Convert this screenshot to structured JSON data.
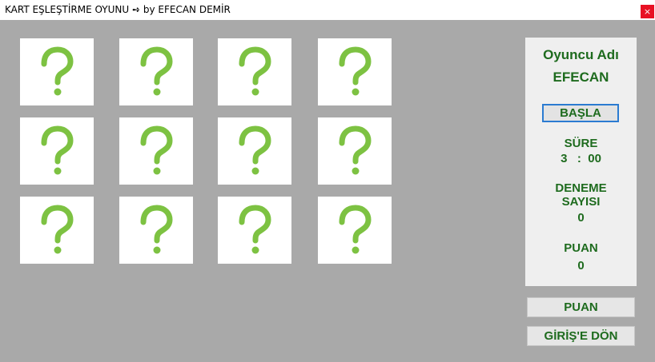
{
  "window": {
    "title": "KART EŞLEŞTİRME OYUNU ➺ by EFECAN DEMİR",
    "close_label": "×"
  },
  "cards": [
    {
      "face": "?"
    },
    {
      "face": "?"
    },
    {
      "face": "?"
    },
    {
      "face": "?"
    },
    {
      "face": "?"
    },
    {
      "face": "?"
    },
    {
      "face": "?"
    },
    {
      "face": "?"
    },
    {
      "face": "?"
    },
    {
      "face": "?"
    },
    {
      "face": "?"
    },
    {
      "face": "?"
    }
  ],
  "panel": {
    "player_label": "Oyuncu Adı",
    "player_name": "EFECAN",
    "start_button": "BAŞLA",
    "time_label": "SÜRE",
    "time_value": "3   :  00",
    "attempts_label_line1": "DENEME",
    "attempts_label_line2": "SAYISI",
    "attempts_value": "0",
    "score_label": "PUAN",
    "score_value": "0"
  },
  "buttons": {
    "score": "PUAN",
    "back": "GİRİŞ'E DÖN"
  },
  "colors": {
    "background": "#a9a9a9",
    "accent_text": "#1e6b1e",
    "question_mark": "#7dc242"
  }
}
